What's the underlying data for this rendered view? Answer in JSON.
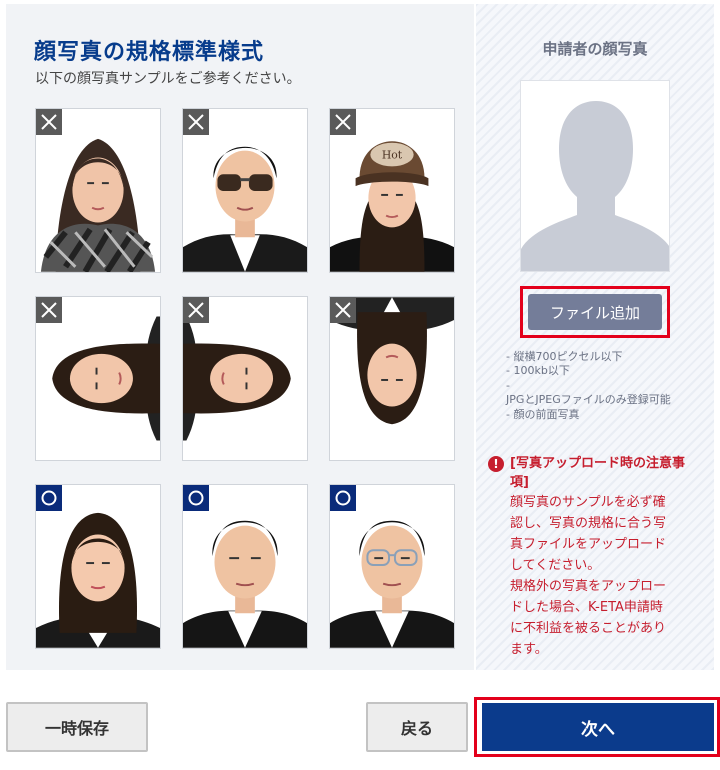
{
  "left": {
    "title": "顔写真の規格標準様式",
    "subtitle": "以下の顔写真サンプルをご参考ください。"
  },
  "samples": [
    {
      "status": "invalid",
      "issue": "scarf",
      "icon": "x-mark-icon"
    },
    {
      "status": "invalid",
      "issue": "sunglasses",
      "icon": "x-mark-icon"
    },
    {
      "status": "invalid",
      "issue": "cap",
      "icon": "x-mark-icon"
    },
    {
      "status": "invalid",
      "issue": "rotated-left",
      "icon": "x-mark-icon"
    },
    {
      "status": "invalid",
      "issue": "rotated-right",
      "icon": "x-mark-icon"
    },
    {
      "status": "invalid",
      "issue": "upside-down",
      "icon": "x-mark-icon"
    },
    {
      "status": "valid",
      "issue": "none",
      "icon": "circle-mark-icon"
    },
    {
      "status": "valid",
      "issue": "none",
      "icon": "circle-mark-icon"
    },
    {
      "status": "valid",
      "issue": "glasses-ok",
      "icon": "circle-mark-icon"
    }
  ],
  "right": {
    "title": "申請者の顔写真",
    "add_file_label": "ファイル追加",
    "requirements": [
      "- 縦横700ピクセル以下",
      "- 100kb以下",
      "-",
      "JPGとJPEGファイルのみ登録可能",
      "- 顔の前面写真"
    ],
    "warning_title": "[写真アップロード時の注意事項]",
    "warning_body": [
      "顔写真のサンプルを必ず確",
      "認し、写真の規格に合う写",
      "真ファイルをアップロード",
      "してください。",
      "規格外の写真をアップロー",
      "ドした場合、K-ETA申請時",
      "に不利益を被ることがあり",
      "ます。"
    ]
  },
  "buttons": {
    "save": "一時保存",
    "back": "戻る",
    "next": "次へ"
  },
  "colors": {
    "title": "#073c8c",
    "primary": "#0b3b8c",
    "warning": "#c61e2e",
    "highlight": "#e3001b",
    "add_button": "#747d99"
  }
}
